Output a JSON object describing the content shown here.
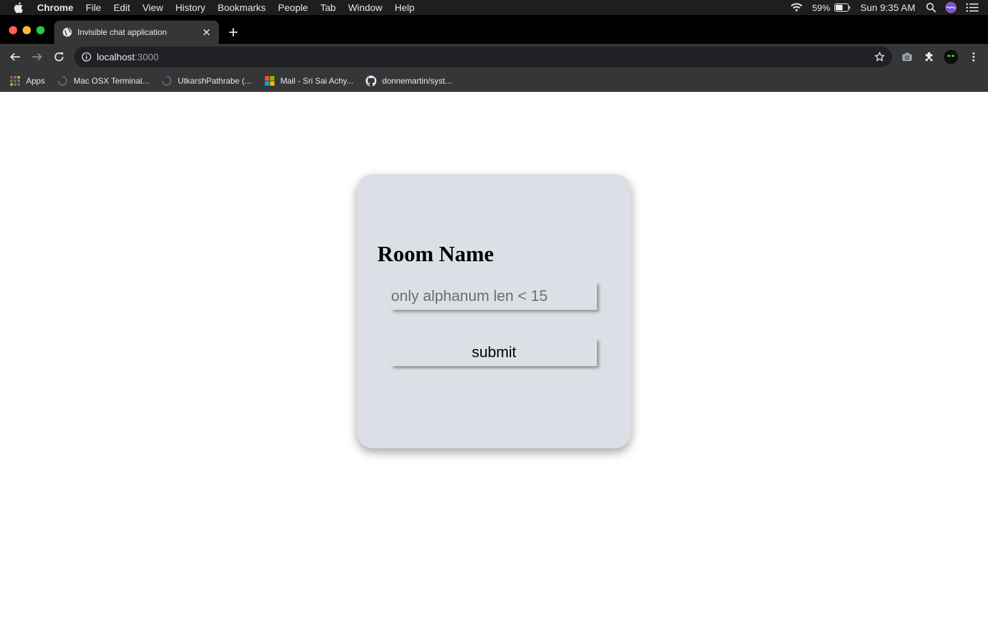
{
  "menubar": {
    "app_name": "Chrome",
    "items": [
      "File",
      "Edit",
      "View",
      "History",
      "Bookmarks",
      "People",
      "Tab",
      "Window",
      "Help"
    ],
    "battery_percent": "59%",
    "clock": "Sun 9:35 AM"
  },
  "browser": {
    "tab_title": "Invisible chat application",
    "url_host": "localhost",
    "url_port": ":3000",
    "bookmarks": [
      "Apps",
      "Mac OSX Terminal...",
      "UtkarshPathrabe (...",
      "Mail - Sri Sai Achy...",
      "donnemartin/syst..."
    ]
  },
  "card": {
    "title": "Room Name",
    "input_placeholder": "only alphanum len < 15",
    "input_value": "",
    "submit_label": "submit"
  },
  "colors": {
    "card_background": "#dcdfe5",
    "browser_chrome": "#353638",
    "tab_strip": "#000000"
  }
}
